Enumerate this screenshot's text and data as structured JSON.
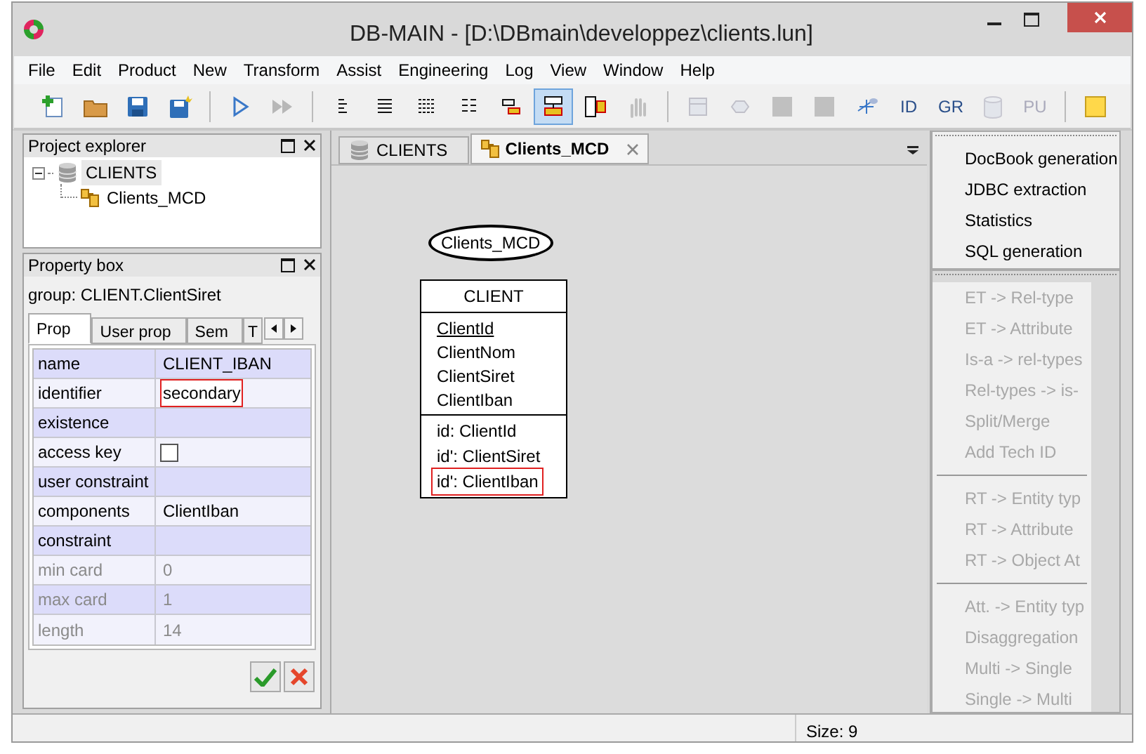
{
  "window": {
    "title": "DB-MAIN  - [D:\\DBmain\\developpez\\clients.lun]"
  },
  "menu": [
    "File",
    "Edit",
    "Product",
    "New",
    "Transform",
    "Assist",
    "Engineering",
    "Log",
    "View",
    "Window",
    "Help"
  ],
  "toolbar": [
    {
      "kind": "new",
      "selected": false,
      "disabled": false
    },
    {
      "kind": "folder",
      "selected": false,
      "disabled": false
    },
    {
      "kind": "save",
      "selected": false,
      "disabled": false
    },
    {
      "kind": "saveas",
      "selected": false,
      "disabled": false
    },
    {
      "kind": "sep"
    },
    {
      "kind": "play",
      "selected": false,
      "disabled": false
    },
    {
      "kind": "fastforward",
      "selected": false,
      "disabled": true
    },
    {
      "kind": "sep"
    },
    {
      "kind": "lines1",
      "selected": false,
      "disabled": false
    },
    {
      "kind": "lines2",
      "selected": false,
      "disabled": false
    },
    {
      "kind": "lines3",
      "selected": false,
      "disabled": false
    },
    {
      "kind": "lines4",
      "selected": false,
      "disabled": false
    },
    {
      "kind": "graph1",
      "selected": false,
      "disabled": false
    },
    {
      "kind": "graph2",
      "selected": true,
      "disabled": false
    },
    {
      "kind": "graph3",
      "selected": false,
      "disabled": false
    },
    {
      "kind": "hand",
      "selected": false,
      "disabled": true
    },
    {
      "kind": "sep"
    },
    {
      "kind": "entity",
      "selected": false,
      "disabled": true
    },
    {
      "kind": "rel",
      "selected": false,
      "disabled": true
    },
    {
      "kind": "square",
      "selected": false,
      "disabled": true
    },
    {
      "kind": "square",
      "selected": false,
      "disabled": true
    },
    {
      "kind": "link",
      "selected": false,
      "disabled": false
    },
    {
      "kind": "text",
      "label": "ID",
      "selected": false,
      "disabled": false
    },
    {
      "kind": "text",
      "label": "GR",
      "selected": false,
      "disabled": false
    },
    {
      "kind": "cylinder",
      "selected": false,
      "disabled": true
    },
    {
      "kind": "text",
      "label": "PU",
      "selected": false,
      "disabled": true
    },
    {
      "kind": "sep"
    },
    {
      "kind": "note",
      "selected": false,
      "disabled": false
    }
  ],
  "project_explorer": {
    "title": "Project explorer",
    "tree": [
      {
        "label": "CLIENTS",
        "kind": "database",
        "selected": true,
        "expanded": true,
        "children": [
          {
            "label": "Clients_MCD",
            "kind": "schema",
            "selected": false
          }
        ]
      }
    ]
  },
  "property_box": {
    "title": "Property box",
    "subject": "group: CLIENT.ClientSiret",
    "tabs": [
      {
        "label": "Prop",
        "selected": true
      },
      {
        "label": "User prop",
        "selected": false
      },
      {
        "label": "Sem",
        "selected": false
      },
      {
        "label": "T",
        "selected": false
      }
    ],
    "rows": [
      {
        "name": "name",
        "kind": "text",
        "value": "CLIENT_IBAN",
        "disabled": false,
        "outlined": false
      },
      {
        "name": "identifier",
        "kind": "text",
        "value": "secondary",
        "disabled": false,
        "outlined": true
      },
      {
        "name": "existence",
        "kind": "text",
        "disabled": false,
        "outlined": false
      },
      {
        "name": "access key",
        "kind": "checkbox",
        "checked": false,
        "disabled": false
      },
      {
        "name": "user constraint",
        "kind": "text",
        "disabled": false,
        "outlined": false
      },
      {
        "name": "components",
        "kind": "text",
        "value": "ClientIban",
        "disabled": false,
        "outlined": false
      },
      {
        "name": "constraint",
        "kind": "text",
        "disabled": false,
        "outlined": false
      },
      {
        "name": "min card",
        "kind": "text",
        "value": "0",
        "disabled": true,
        "outlined": false
      },
      {
        "name": "max card",
        "kind": "text",
        "value": "1",
        "disabled": true,
        "outlined": false
      },
      {
        "name": "length",
        "kind": "text",
        "value": "14",
        "disabled": true,
        "outlined": false
      }
    ]
  },
  "editor_tabs": [
    {
      "label": "CLIENTS",
      "kind": "database",
      "selected": false,
      "closable": false
    },
    {
      "label": "Clients_MCD",
      "kind": "schema",
      "selected": true,
      "closable": true
    }
  ],
  "diagram": {
    "schema": "Clients_MCD",
    "entity": {
      "name": "CLIENT",
      "attributes": [
        {
          "name": "ClientId",
          "primary": true
        },
        {
          "name": "ClientNom",
          "primary": false
        },
        {
          "name": "ClientSiret",
          "primary": false
        },
        {
          "name": "ClientIban",
          "primary": false
        }
      ],
      "groups": [
        {
          "label": "id: ClientId",
          "outlined": false
        },
        {
          "label": "id': ClientSiret",
          "outlined": false
        },
        {
          "label": "id': ClientIban",
          "outlined": true
        }
      ]
    }
  },
  "tools_panel": [
    {
      "kind": "item",
      "label": "DocBook generation",
      "disabled": false
    },
    {
      "kind": "item",
      "label": "JDBC extraction",
      "disabled": false
    },
    {
      "kind": "item",
      "label": "Statistics",
      "disabled": false
    },
    {
      "kind": "item",
      "label": "SQL generation",
      "disabled": false
    }
  ],
  "transform_panel": [
    {
      "kind": "item",
      "label": "ET -> Rel-type",
      "disabled": true
    },
    {
      "kind": "item",
      "label": "ET -> Attribute",
      "disabled": true
    },
    {
      "kind": "item",
      "label": "Is-a -> rel-types",
      "disabled": true
    },
    {
      "kind": "item",
      "label": "Rel-types -> is-",
      "disabled": true
    },
    {
      "kind": "item",
      "label": "Split/Merge",
      "disabled": true
    },
    {
      "kind": "item",
      "label": "Add Tech ID",
      "disabled": true
    },
    {
      "kind": "sep"
    },
    {
      "kind": "item",
      "label": "RT -> Entity typ",
      "disabled": true
    },
    {
      "kind": "item",
      "label": "RT -> Attribute",
      "disabled": true
    },
    {
      "kind": "item",
      "label": "RT -> Object At",
      "disabled": true
    },
    {
      "kind": "sep"
    },
    {
      "kind": "item",
      "label": "Att. -> Entity typ",
      "disabled": true
    },
    {
      "kind": "item",
      "label": "Disaggregation",
      "disabled": true
    },
    {
      "kind": "item",
      "label": "Multi -> Single",
      "disabled": true
    },
    {
      "kind": "item",
      "label": "Single -> Multi",
      "disabled": true
    }
  ],
  "status_bar": {
    "size": "Size: 9"
  }
}
